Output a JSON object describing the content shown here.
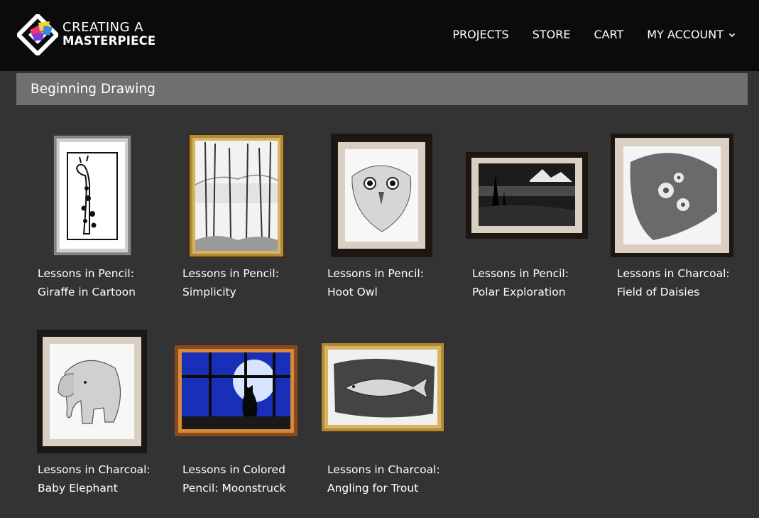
{
  "brand": {
    "line1": "CREATING A",
    "line2": "MASTERPIECE",
    "colors": {
      "pink": "#e6357b",
      "yellow": "#f4d33a",
      "blue": "#3a8bd6",
      "purple": "#7c3ad6"
    }
  },
  "nav": {
    "items": [
      {
        "label": "PROJECTS"
      },
      {
        "label": "STORE"
      },
      {
        "label": "CART"
      },
      {
        "label": "MY ACCOUNT",
        "has_dropdown": true,
        "icon": "chevron-down-icon"
      }
    ]
  },
  "section": {
    "title": "Beginning Drawing"
  },
  "lessons": [
    {
      "line1": "Lessons in Pencil:",
      "line2": "Giraffe in Cartoon",
      "art": "giraffe",
      "frame": "silver"
    },
    {
      "line1": "Lessons in Pencil:",
      "line2": "Simplicity",
      "art": "trees",
      "frame": "gold"
    },
    {
      "line1": "Lessons in Pencil:",
      "line2": "Hoot Owl",
      "art": "owl",
      "frame": "black"
    },
    {
      "line1": "Lessons in Pencil:",
      "line2": "Polar Exploration",
      "art": "polar",
      "frame": "black"
    },
    {
      "line1": "Lessons in Charcoal:",
      "line2": "Field of Daisies",
      "art": "daisies",
      "frame": "black"
    },
    {
      "line1": "Lessons in Charcoal:",
      "line2": "Baby Elephant",
      "art": "elephant",
      "frame": "black"
    },
    {
      "line1": "Lessons in Colored",
      "line2": "Pencil: Moonstruck",
      "art": "moonstruck",
      "frame": "copper"
    },
    {
      "line1": "Lessons in Charcoal:",
      "line2": "Angling for Trout",
      "art": "trout",
      "frame": "gold"
    }
  ]
}
